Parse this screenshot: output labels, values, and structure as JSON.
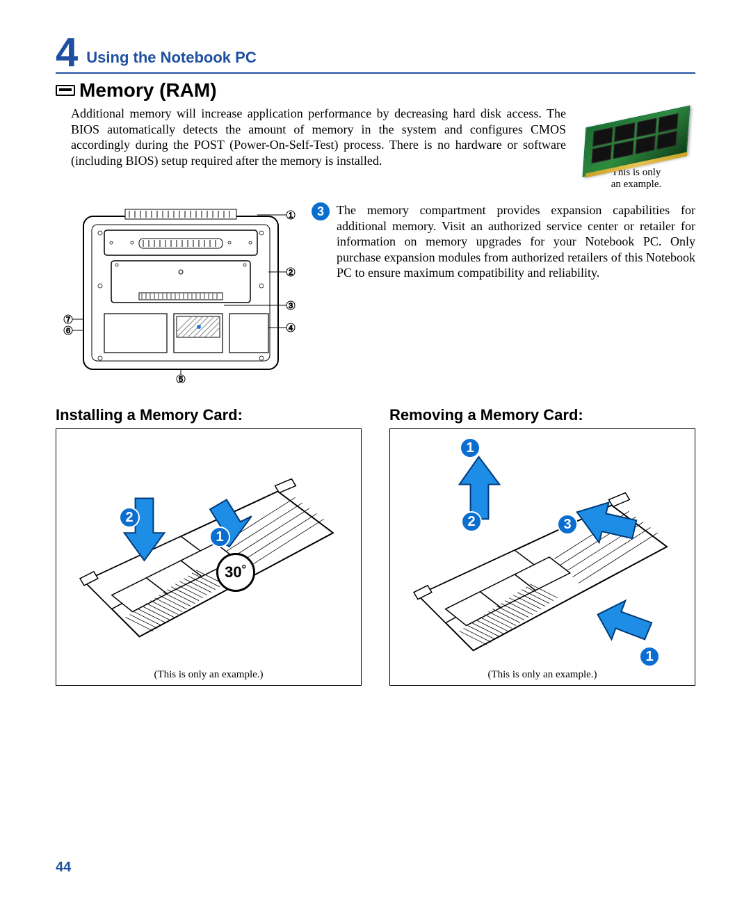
{
  "header": {
    "chapter_number": "4",
    "chapter_title": "Using the Notebook PC"
  },
  "section": {
    "title": "Memory (RAM)",
    "icon_name": "memory-icon",
    "intro": "Additional memory will increase application performance by decreasing hard disk access. The BIOS automatically detects the amount of memory in the system and configures CMOS accordingly during the POST (Power-On-Self-Test) process. There is no hardware or software (including BIOS) setup required after the memory is installed."
  },
  "ram_image": {
    "caption_line1": "This is only",
    "caption_line2": "an example."
  },
  "laptop_diagram": {
    "callouts": [
      "1",
      "2",
      "3",
      "4",
      "5",
      "6",
      "7"
    ]
  },
  "mid": {
    "badge": "3",
    "text": "The memory compartment provides expansion capabilities for additional memory. Visit an authorized service center or retailer for information on memory upgrades for your Notebook PC. Only purchase expansion modules from authorized retailers of this Notebook PC to ensure maximum compatibility and reliability."
  },
  "install": {
    "title": "Installing a Memory Card:",
    "badges": [
      "1",
      "2"
    ],
    "angle": "30˚",
    "caption": "(This is only an example.)"
  },
  "remove": {
    "title": "Removing a Memory Card:",
    "badges": [
      "1",
      "2",
      "3",
      "1"
    ],
    "caption": "(This is only an example.)"
  },
  "page_number": "44"
}
